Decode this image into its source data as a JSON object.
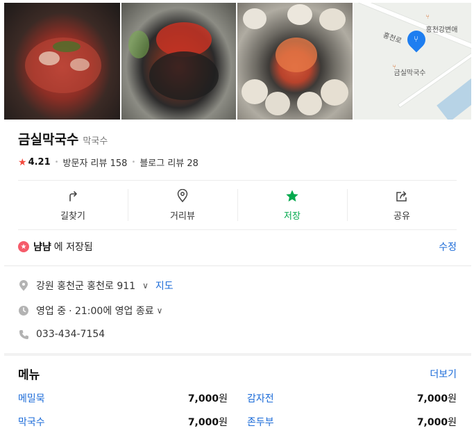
{
  "place": {
    "name": "금실막국수",
    "category": "막국수",
    "rating": "4.21",
    "visitor_reviews": "방문자 리뷰 158",
    "blog_reviews": "블로그 리뷰 28"
  },
  "map": {
    "road_label": "홍천로",
    "landmark_label": "홍천강변애",
    "pin_label": "금실막국수"
  },
  "actions": [
    {
      "label": "길찾기",
      "icon": "directions-icon"
    },
    {
      "label": "거리뷰",
      "icon": "location-pin-icon"
    },
    {
      "label": "저장",
      "icon": "star-icon",
      "color": "#03a94d"
    },
    {
      "label": "공유",
      "icon": "share-icon"
    }
  ],
  "saved": {
    "user": "냠냠",
    "text": "에 저장됨",
    "edit_label": "수정"
  },
  "info": {
    "address": "강원 홍천군 홍천로 911",
    "map_link": "지도",
    "status": "영업 중",
    "hours": "· 21:00에 영업 종료",
    "phone": "033-434-7154"
  },
  "menu": {
    "title": "메뉴",
    "more_label": "더보기",
    "items": [
      {
        "name": "메밀묵",
        "price": "7,000",
        "unit": "원"
      },
      {
        "name": "감자전",
        "price": "7,000",
        "unit": "원"
      },
      {
        "name": "막국수",
        "price": "7,000",
        "unit": "원"
      },
      {
        "name": "존두부",
        "price": "7,000",
        "unit": "원"
      }
    ]
  },
  "colors": {
    "accent_green": "#03a94d",
    "link_blue": "#1b6bd8",
    "star_red": "#f24a3e",
    "pin_blue": "#1e7ef0"
  }
}
